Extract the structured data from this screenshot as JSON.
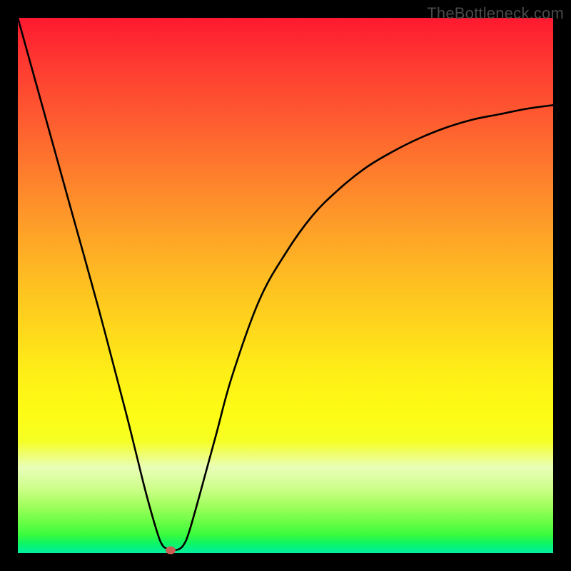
{
  "watermark": "TheBottleneck.com",
  "chart_data": {
    "type": "line",
    "title": "",
    "xlabel": "",
    "ylabel": "",
    "xlim": [
      0,
      100
    ],
    "ylim": [
      0,
      100
    ],
    "legend": false,
    "series": [
      {
        "name": "bottleneck-curve",
        "x": [
          0,
          5,
          10,
          15,
          20,
          22,
          24,
          26,
          27,
          28,
          29,
          30,
          31,
          32,
          34,
          37,
          40,
          45,
          50,
          55,
          60,
          65,
          70,
          75,
          80,
          85,
          90,
          95,
          100
        ],
        "y": [
          100,
          82,
          64,
          46,
          27,
          19,
          11,
          4,
          1.5,
          0.8,
          0.6,
          0.7,
          1.6,
          4,
          11,
          22,
          33,
          47,
          56,
          63,
          68,
          72,
          75,
          77.5,
          79.5,
          81,
          82,
          83,
          83.7
        ]
      }
    ],
    "marker": {
      "x": 28.5,
      "y": 0.6,
      "color": "#c95e52"
    },
    "background_gradient": {
      "stops": [
        {
          "pos": 0,
          "color": "#fe1930"
        },
        {
          "pos": 50,
          "color": "#fecf1e"
        },
        {
          "pos": 78,
          "color": "#fdfc15"
        },
        {
          "pos": 100,
          "color": "#02f0a0"
        }
      ]
    }
  }
}
